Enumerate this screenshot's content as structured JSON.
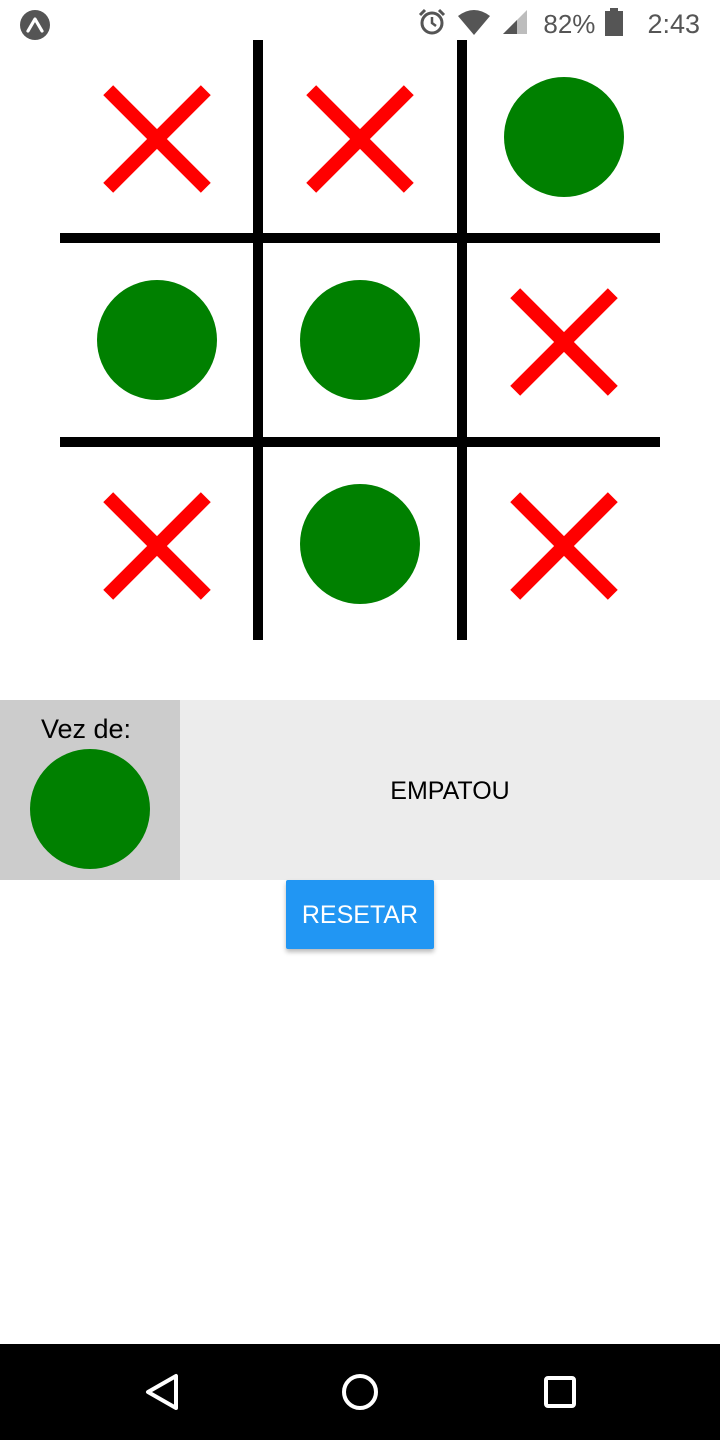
{
  "status_bar": {
    "left_icon": "expo-icon",
    "icons": [
      "alarm-icon",
      "wifi-icon",
      "cell-signal-icon",
      "battery-icon"
    ],
    "battery_percent": "82%",
    "time": "2:43"
  },
  "board": {
    "cells": [
      {
        "mark": "X"
      },
      {
        "mark": "X"
      },
      {
        "mark": "O"
      },
      {
        "mark": "O"
      },
      {
        "mark": "O"
      },
      {
        "mark": "X"
      },
      {
        "mark": "X"
      },
      {
        "mark": "O"
      },
      {
        "mark": "X"
      }
    ],
    "colors": {
      "x": "#ff0000",
      "o": "#008000",
      "lines": "#000000"
    }
  },
  "info": {
    "turn_label": "Vez de:",
    "turn_mark": "O",
    "result": "EMPATOU"
  },
  "actions": {
    "reset_label": "RESETAR",
    "reset_color": "#2196f3"
  },
  "nav_bar": {
    "buttons": [
      "back-icon",
      "home-icon",
      "recents-icon"
    ]
  }
}
